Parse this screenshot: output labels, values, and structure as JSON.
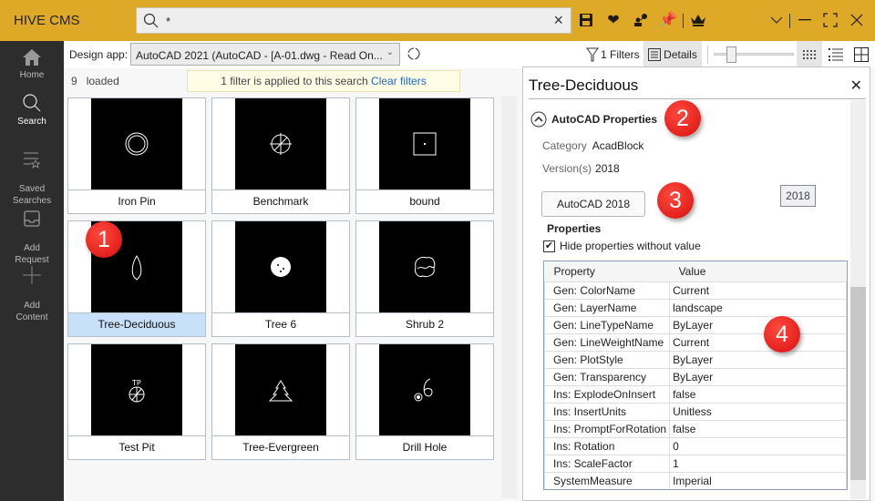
{
  "app": {
    "title": "HIVE CMS"
  },
  "search": {
    "value": "*",
    "placeholder": ""
  },
  "toolbar_icons": [
    "save-icon",
    "heart-icon",
    "share-user-icon",
    "pin-icon",
    "crown-icon",
    "chevron-down-icon",
    "minimize-icon",
    "maximize-icon",
    "close-icon"
  ],
  "sidebar": {
    "items": [
      {
        "label": "Home",
        "icon": "home-icon"
      },
      {
        "label": "Search",
        "icon": "search-icon",
        "active": true
      },
      {
        "label": "Saved\nSearches",
        "icon": "saved-searches-icon"
      },
      {
        "label": "Add\nRequest",
        "icon": "inbox-icon"
      },
      {
        "label": "Add\nContent",
        "icon": "plus-icon"
      }
    ]
  },
  "toolrow": {
    "design_app_label": "Design app:",
    "design_app_value": "AutoCAD 2021 (AutoCAD  - [A-01.dwg - Read On...",
    "filters_label": "1 Filters",
    "details_label": "Details"
  },
  "results": {
    "count": "9",
    "loaded_label": "loaded",
    "filter_banner": "1 filter is applied to this search",
    "clear_filters": "Clear filters",
    "items": [
      {
        "name": "Iron Pin"
      },
      {
        "name": "Benchmark"
      },
      {
        "name": "bound"
      },
      {
        "name": "Tree-Deciduous",
        "selected": true
      },
      {
        "name": "Tree 6"
      },
      {
        "name": "Shrub 2"
      },
      {
        "name": "Test Pit"
      },
      {
        "name": "Tree-Evergreen"
      },
      {
        "name": "Drill Hole"
      }
    ]
  },
  "details": {
    "title": "Tree-Deciduous",
    "section_title": "AutoCAD Properties",
    "category_label": "Category",
    "category_value": "AcadBlock",
    "versions_label": "Version(s)",
    "versions_value": "2018",
    "app_button": "AutoCAD  2018",
    "version_badge": "2018",
    "properties_heading": "Properties",
    "hide_empty_label": "Hide properties without value",
    "hide_empty_checked": true,
    "table": {
      "columns": [
        "Property",
        "Value"
      ],
      "rows": [
        [
          "Gen: ColorName",
          "Current"
        ],
        [
          "Gen: LayerName",
          "landscape"
        ],
        [
          "Gen: LineTypeName",
          "ByLayer"
        ],
        [
          "Gen: LineWeightName",
          "Current"
        ],
        [
          "Gen: PlotStyle",
          "ByLayer"
        ],
        [
          "Gen: Transparency",
          "ByLayer"
        ],
        [
          "Ins: ExplodeOnInsert",
          "false"
        ],
        [
          "Ins: InsertUnits",
          "Unitless"
        ],
        [
          "Ins: PromptForRotation",
          "false"
        ],
        [
          "Ins: Rotation",
          "0"
        ],
        [
          "Ins: ScaleFactor",
          "1"
        ],
        [
          "SystemMeasure",
          "Imperial"
        ]
      ]
    }
  },
  "annotations": [
    "1",
    "2",
    "3",
    "4"
  ]
}
